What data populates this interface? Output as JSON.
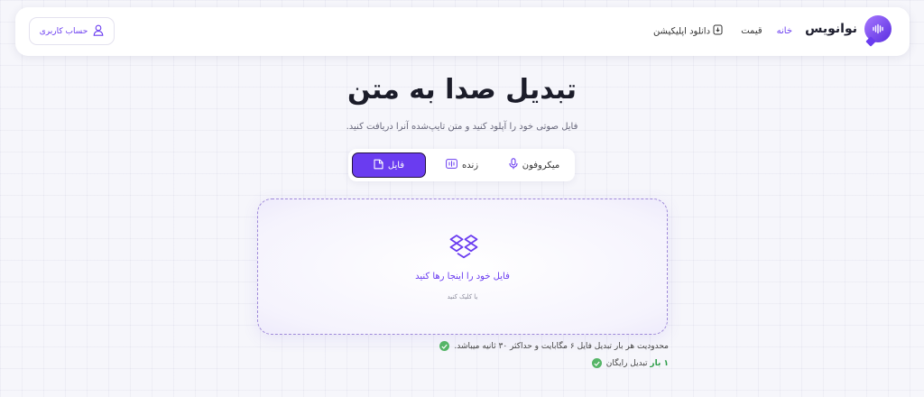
{
  "navbar": {
    "brand_name": "نوانویس",
    "links": [
      {
        "label": "خانه",
        "active": true
      },
      {
        "label": "قیمت",
        "active": false
      },
      {
        "label": "دانلود اپلیکیشن",
        "active": false
      }
    ],
    "account_label": "حساب کاربری"
  },
  "hero": {
    "title": "تبدیل صدا به متن",
    "subtitle": "فایل صوتی خود را آپلود کنید و متن تایپ‌شده آنرا دریافت کنید."
  },
  "tabs": [
    {
      "label": "میکروفون",
      "icon": "microphone-icon",
      "active": false
    },
    {
      "label": "زنده",
      "icon": "waveform-icon",
      "active": false
    },
    {
      "label": "فایل",
      "icon": "file-icon",
      "active": true
    }
  ],
  "dropzone": {
    "text": "فایل خود را اینجا رها کنید",
    "subtext": "یا کلیک کنید"
  },
  "notes": [
    {
      "text": "محدودیت هر بار تبدیل فایل ۶ مگابایت و حداکثر ۳۰ ثانیه میباشد."
    },
    {
      "highlight": "۱ بار",
      "text": " تبدیل رایگان"
    }
  ],
  "colors": {
    "accent": "#6a3cf0",
    "success": "#55b567",
    "background": "#f6f6fb"
  }
}
